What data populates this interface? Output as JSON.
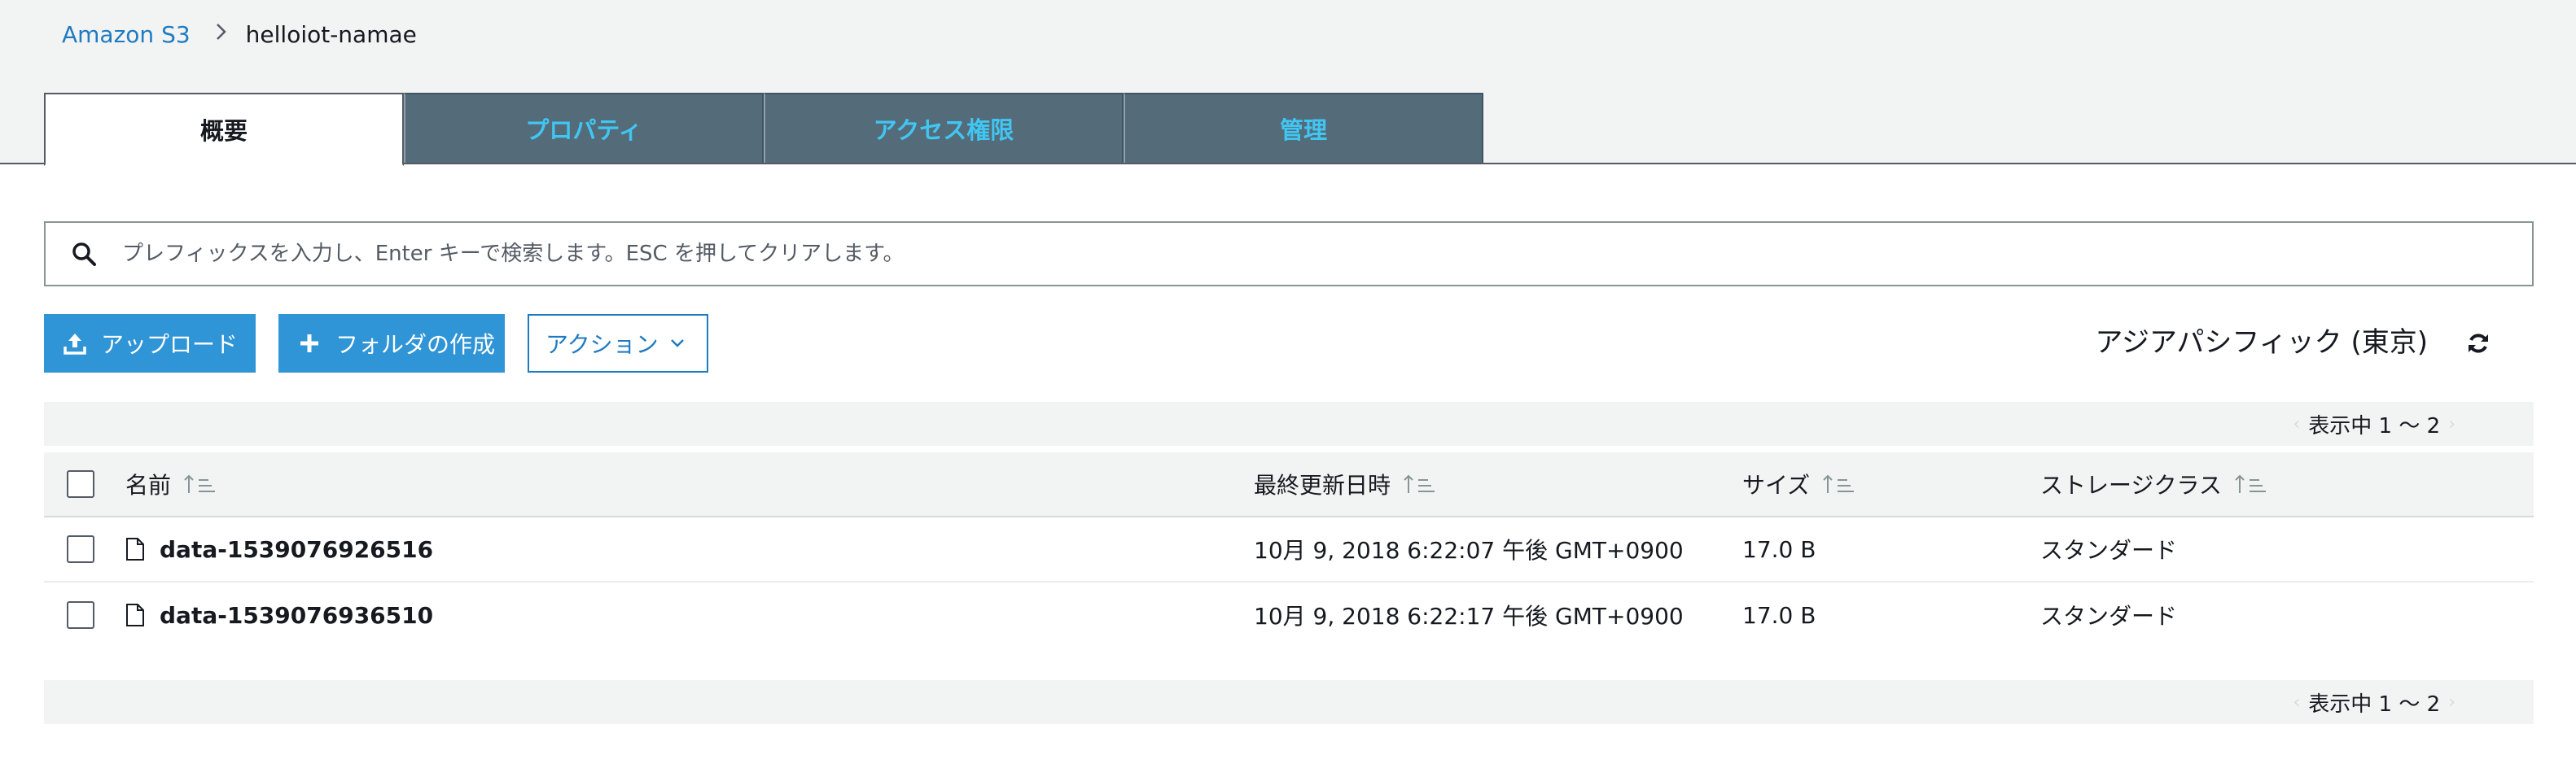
{
  "breadcrumb": {
    "root": "Amazon S3",
    "current": "helloiot-namae"
  },
  "tabs": [
    {
      "label": "概要",
      "active": true
    },
    {
      "label": "プロパティ",
      "active": false
    },
    {
      "label": "アクセス権限",
      "active": false
    },
    {
      "label": "管理",
      "active": false
    }
  ],
  "search": {
    "placeholder": "プレフィックスを入力し、Enter キーで検索します。ESC を押してクリアします。",
    "value": ""
  },
  "toolbar": {
    "upload_label": "アップロード",
    "create_folder_label": "フォルダの作成",
    "actions_label": "アクション",
    "region_label": "アジアパシフィック (東京)"
  },
  "pager": {
    "text": "表示中 1 〜 2"
  },
  "table": {
    "headers": {
      "name": "名前",
      "last_modified": "最終更新日時",
      "size": "サイズ",
      "storage_class": "ストレージクラス"
    },
    "rows": [
      {
        "name": "data-1539076926516",
        "last_modified": "10月 9, 2018 6:22:07 午後 GMT+0900",
        "size": "17.0 B",
        "storage_class": "スタンダード"
      },
      {
        "name": "data-1539076936510",
        "last_modified": "10月 9, 2018 6:22:17 午後 GMT+0900",
        "size": "17.0 B",
        "storage_class": "スタンダード"
      }
    ]
  },
  "colors": {
    "accent": "#2f95d6",
    "link": "#1f7bc1",
    "tab_bg": "#546b7a",
    "tab_text": "#41c6f2"
  }
}
